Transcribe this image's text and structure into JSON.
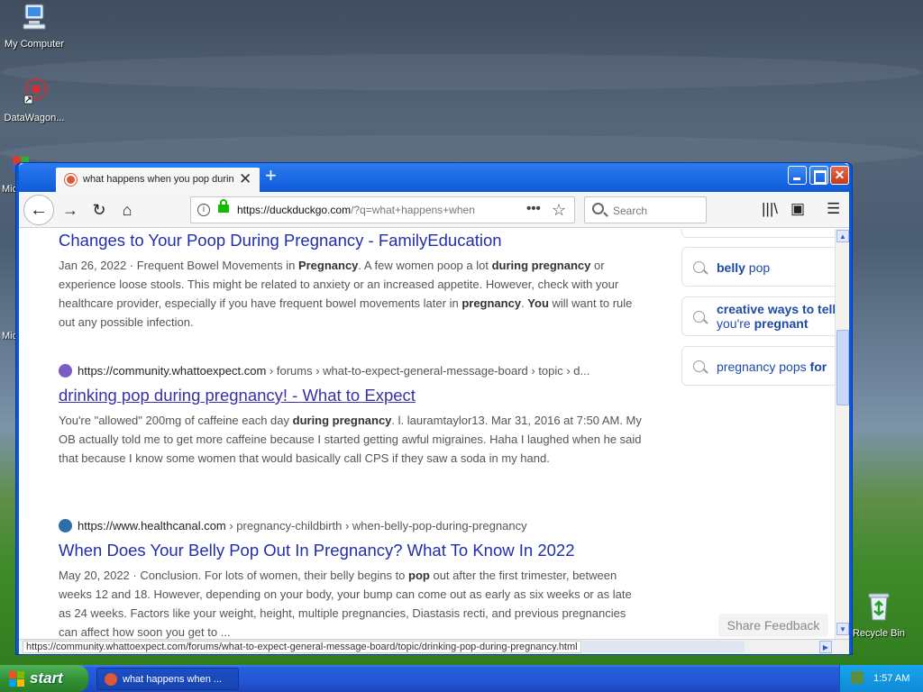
{
  "desktop": {
    "icons": [
      {
        "label": "My Computer"
      },
      {
        "label": "DataWagon..."
      },
      {
        "label": "Mic"
      },
      {
        "label": "Mic"
      },
      {
        "label": "Recycle Bin"
      }
    ]
  },
  "browser": {
    "tab_title": "what happens when you pop during",
    "new_tab": "+",
    "url_host": "https://duckduckgo.com",
    "url_rest": "/?q=what+happens+when",
    "search_placeholder": "Search",
    "status_url": "https://community.whattoexpect.com/forums/what-to-expect-general-message-board/topic/drinking-pop-during-pregnancy.html"
  },
  "results": [
    {
      "title": "Changes to Your Poop During Pregnancy - FamilyEducation",
      "snippet_parts": [
        "Jan 26, 2022 · Frequent Bowel Movements in ",
        "Pregnancy",
        ". A few women poop a lot ",
        "during pregnancy",
        " or experience loose stools. This might be related to anxiety or an increased appetite. However, check with your healthcare provider, especially if you have frequent bowel movements later in ",
        "pregnancy",
        ". ",
        "You",
        " will want to rule out any possible infection."
      ]
    },
    {
      "site": "https://community.whattoexpect.com",
      "path": " › forums › what-to-expect-general-message-board › topic › d...",
      "title": "drinking pop during pregnancy! - What to Expect",
      "snippet_parts": [
        "You're \"allowed\" 200mg of caffeine each day ",
        "during pregnancy",
        ". l. lauramtaylor13. Mar 31, 2016 at 7:50 AM. My OB actually told me to get more caffeine because I started getting awful migraines. Haha I laughed when he said that because I know some women that would basically call CPS if they saw a soda in my hand."
      ]
    },
    {
      "site": "https://www.healthcanal.com",
      "path": " › pregnancy-childbirth › when-belly-pop-during-pregnancy",
      "title": "When Does Your Belly Pop Out In Pregnancy? What To Know In 2022",
      "snippet_parts": [
        "May 20, 2022 · Conclusion. For lots of women, their belly begins to ",
        "pop",
        " out after the first trimester, between weeks 12 and 18. However, depending on your body, your bump can come out as early as six weeks or as late as 24 weeks. Factors like your weight, height, multiple pregnancies, Diastasis recti, and previous pregnancies can affect how soon you get to ..."
      ]
    }
  ],
  "related": [
    {
      "bold": "belly",
      "rest": " pop"
    },
    {
      "bold": "creative ways to tell",
      "rest2": "you're",
      "bold2": " pregnant"
    },
    {
      "rest": "pregnancy pops ",
      "bold": "for"
    }
  ],
  "feedback_label": "Share Feedback",
  "taskbar": {
    "start_label": "start",
    "task_label": "what happens when ...",
    "clock": "1:57 AM"
  },
  "colors": {
    "link": "#202ead",
    "accent": "#0a58d8",
    "duck": "#de5833"
  }
}
